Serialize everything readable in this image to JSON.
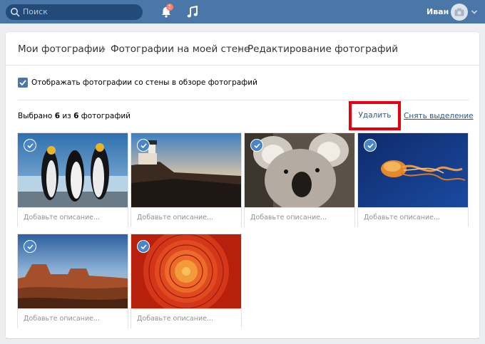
{
  "topbar": {
    "search_placeholder": "Поиск",
    "notifications_count": "1",
    "user_name": "Иван"
  },
  "breadcrumb": {
    "items": [
      "Мои фотографии",
      "Фотографии на моей стене",
      "Редактирование фотографий"
    ]
  },
  "wall_option": {
    "label": "Отображать фотографии со стены в обзоре фотографий",
    "checked": true
  },
  "selection": {
    "prefix": "Выбрано",
    "selected": "6",
    "middle": "из",
    "total": "6",
    "suffix": "фотографий",
    "delete_label": "Удалить",
    "unselect_label": "Снять выделение"
  },
  "photos": [
    {
      "subject": "penguins",
      "selected": true,
      "description_placeholder": "Добавьте описание..."
    },
    {
      "subject": "lighthouse",
      "selected": true,
      "description_placeholder": "Добавьте описание..."
    },
    {
      "subject": "koala",
      "selected": true,
      "description_placeholder": "Добавьте описание..."
    },
    {
      "subject": "jellyfish",
      "selected": true,
      "description_placeholder": "Добавьте описание..."
    },
    {
      "subject": "desert",
      "selected": true,
      "description_placeholder": "Добавьте описание..."
    },
    {
      "subject": "chrysanthemum",
      "selected": true,
      "description_placeholder": "Добавьте описание..."
    }
  ],
  "colors": {
    "header": "#4a76a8",
    "accent": "#4a86c5",
    "link": "#2a5885",
    "highlight_box": "#e8000c"
  }
}
